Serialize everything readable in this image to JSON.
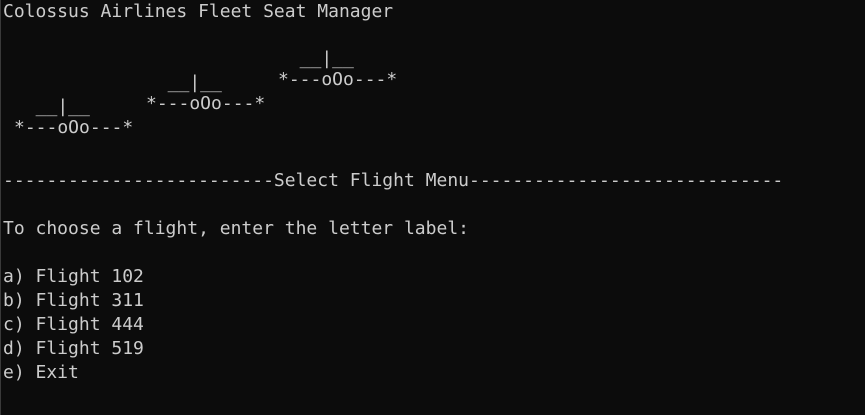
{
  "title": "Colossus Airlines Fleet Seat Manager",
  "planes": [
    {
      "top": "  __|__",
      "bottom": "*---oOo---*"
    },
    {
      "top": "  __|__",
      "bottom": "*---oOo---*"
    },
    {
      "top": "  __|__",
      "bottom": "*---oOo---*"
    }
  ],
  "menu_header": "-------------------------Select Flight Menu-----------------------------",
  "prompt": "To choose a flight, enter the letter label:",
  "options": [
    {
      "label": "a) Flight 102"
    },
    {
      "label": "b) Flight 311"
    },
    {
      "label": "c) Flight 444"
    },
    {
      "label": "d) Flight 519"
    },
    {
      "label": "e) Exit"
    }
  ]
}
